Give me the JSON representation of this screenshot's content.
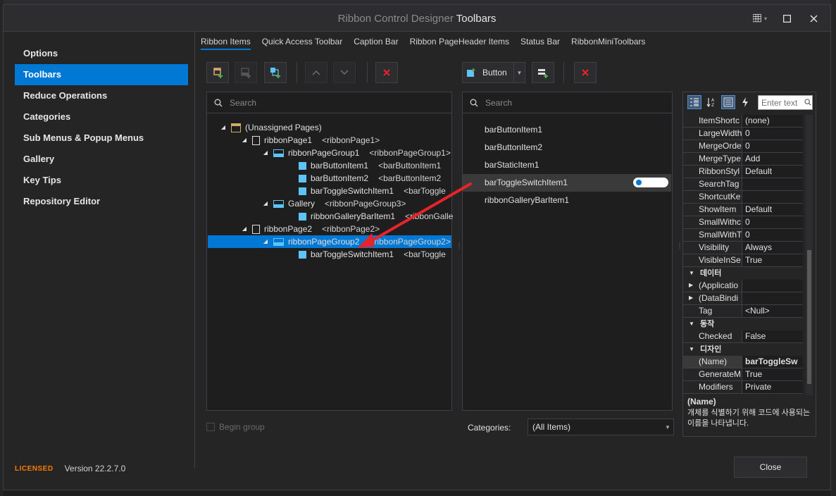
{
  "window": {
    "title_prefix": "Ribbon Control Designer",
    "title_main": "Toolbars"
  },
  "nav": {
    "items": [
      {
        "label": "Options"
      },
      {
        "label": "Toolbars"
      },
      {
        "label": "Reduce Operations"
      },
      {
        "label": "Categories"
      },
      {
        "label": "Sub Menus & Popup Menus"
      },
      {
        "label": "Gallery"
      },
      {
        "label": "Key Tips"
      },
      {
        "label": "Repository Editor"
      }
    ]
  },
  "footer": {
    "licensed": "LICENSED",
    "version": "Version 22.2.7.0"
  },
  "tabs": [
    {
      "label": "Ribbon Items"
    },
    {
      "label": "Quick Access Toolbar"
    },
    {
      "label": "Caption Bar"
    },
    {
      "label": "Ribbon PageHeader Items"
    },
    {
      "label": "Status Bar"
    },
    {
      "label": "RibbonMiniToolbars"
    }
  ],
  "item_type": {
    "value": "Button"
  },
  "left_panel": {
    "search_placeholder": "Search",
    "tree": [
      {
        "label": "(Unassigned Pages)",
        "tag": ""
      },
      {
        "label": "ribbonPage1",
        "tag": "<ribbonPage1>"
      },
      {
        "label": "ribbonPageGroup1",
        "tag": "<ribbonPageGroup1>"
      },
      {
        "label": "barButtonItem1",
        "tag": "<barButtonItem1"
      },
      {
        "label": "barButtonItem2",
        "tag": "<barButtonItem2"
      },
      {
        "label": "barToggleSwitchItem1",
        "tag": "<barToggle"
      },
      {
        "label": "Gallery",
        "tag": "<ribbonPageGroup3>"
      },
      {
        "label": "ribbonGalleryBarItem1",
        "tag": "<ribbonGalle"
      },
      {
        "label": "ribbonPage2",
        "tag": "<ribbonPage2>"
      },
      {
        "label": "ribbonPageGroup2",
        "tag": "<ribbonPageGroup2>"
      },
      {
        "label": "barToggleSwitchItem1",
        "tag": "<barToggle"
      }
    ],
    "begin_group": "Begin group"
  },
  "middle_panel": {
    "search_placeholder": "Search",
    "items": [
      {
        "label": "barButtonItem1"
      },
      {
        "label": "barButtonItem2"
      },
      {
        "label": "barStaticItem1"
      },
      {
        "label": "barToggleSwitchItem1"
      },
      {
        "label": "ribbonGalleryBarItem1"
      }
    ],
    "categories_label": "Categories:",
    "categories_value": "(All Items)"
  },
  "property_grid": {
    "search_placeholder": "Enter text",
    "rows": [
      {
        "name": "ItemShortc",
        "value": "(none)"
      },
      {
        "name": "LargeWidth",
        "value": "0"
      },
      {
        "name": "MergeOrde",
        "value": "0"
      },
      {
        "name": "MergeType",
        "value": "Add"
      },
      {
        "name": "RibbonStyl",
        "value": "Default"
      },
      {
        "name": "SearchTag",
        "value": ""
      },
      {
        "name": "ShortcutKe",
        "value": ""
      },
      {
        "name": "ShowItem",
        "value": "Default"
      },
      {
        "name": "SmallWithc",
        "value": "0"
      },
      {
        "name": "SmallWithT",
        "value": "0"
      },
      {
        "name": "Visibility",
        "value": "Always"
      },
      {
        "name": "VisibleInSe",
        "value": "True"
      }
    ],
    "cat_data": "데이터",
    "data_rows": [
      {
        "name": "(Applicatio",
        "value": ""
      },
      {
        "name": "(DataBindi",
        "value": ""
      },
      {
        "name": "Tag",
        "value": "<Null>"
      }
    ],
    "cat_behavior": "동작",
    "behavior_rows": [
      {
        "name": "Checked",
        "value": "False"
      }
    ],
    "cat_design": "디자인",
    "design_rows": [
      {
        "name": "(Name)",
        "value": "barToggleSw"
      },
      {
        "name": "GenerateM",
        "value": "True"
      },
      {
        "name": "Modifiers",
        "value": "Private"
      }
    ],
    "desc_title": "(Name)",
    "desc_text": "개체를 식별하기 위해 코드에 사용되는 이름을 나타냅니다."
  },
  "buttons": {
    "close": "Close"
  },
  "colors": {
    "accent": "#0078d4",
    "licensed": "#ff7a00",
    "arrow": "#e8242b",
    "item_icon": "#5ec4f5"
  }
}
